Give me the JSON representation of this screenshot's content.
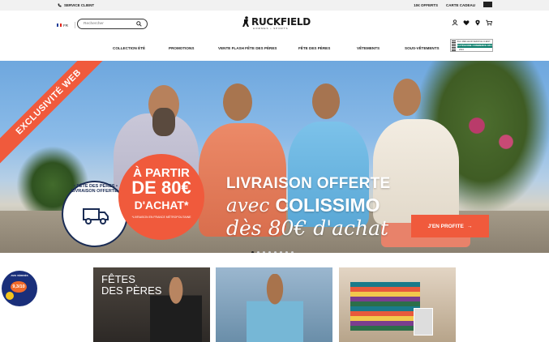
{
  "topbar": {
    "service": "SERVICE CLIENT",
    "offers": "10€ OFFERTS",
    "gift_card": "CARTE CADEAU"
  },
  "header": {
    "lang": "FR",
    "search_placeholder": "Rechercher",
    "logo": "RUCKFIELD",
    "logo_sub": "HOMMES • SPORTS",
    "nav": [
      "COLLECTION ÉTÉ",
      "PROMOTIONS",
      "VENTE FLASH FÊTE DES PÈRES",
      "FÊTE DES PÈRES",
      "VÊTEMENTS",
      "SOUS-VÊTEMENTS"
    ],
    "badge": {
      "line1": "ÉLU MEILLEUR SERVICE CLIENT",
      "line2": "CATÉGORIE COMMERCE EN LIGNE",
      "line3": "2024"
    }
  },
  "hero": {
    "ribbon": "EXCLUSIVITÉ WEB",
    "circle_ring": "• FÊTE DES PÈRES • LIVRAISON OFFERTE •",
    "offer_l1": "À PARTIR",
    "offer_l2": "DE 80€",
    "offer_l3": "D'ACHAT*",
    "offer_note": "*LIVRAISON EN FRANCE MÉTROPOLITAINE",
    "headline_1": "LIVRAISON OFFERTE",
    "headline_2_a": "avec ",
    "headline_2_b": "COLISSIMO",
    "headline_3": "dès 80€ d'achat",
    "cta": "J'EN PROFITE",
    "slides": 8,
    "active_slide": 1
  },
  "cards": [
    {
      "title_1": "FÊTES",
      "title_2": "DES PÈRES"
    },
    {
      "title_1": ""
    },
    {
      "title_1": ""
    }
  ],
  "trust": {
    "score": "9,3/10",
    "label": "AVIS VÉRIFIÉS"
  },
  "colors": {
    "accent": "#f05a3c",
    "navy": "#1a2c54"
  }
}
